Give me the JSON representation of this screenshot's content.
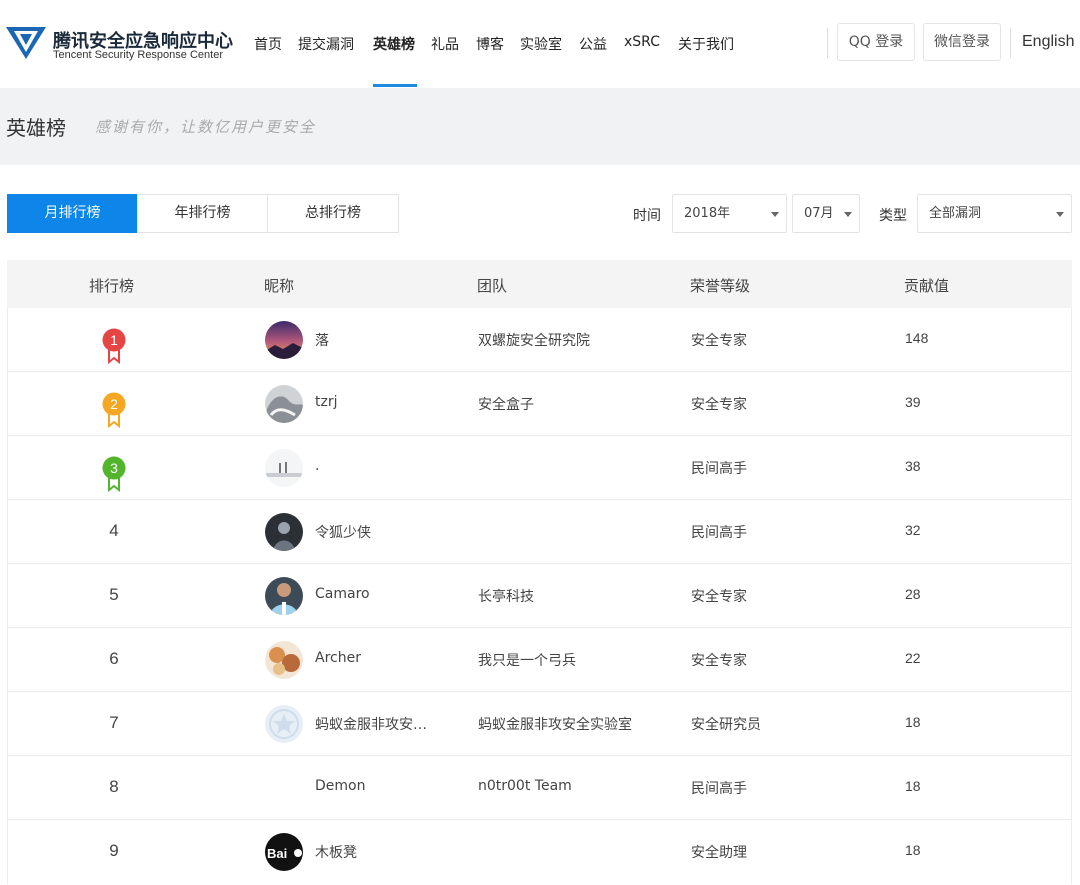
{
  "header": {
    "brand_cn": "腾讯安全应急响应中心",
    "brand_en": "Tencent Security Response Center",
    "nav": [
      {
        "label": "首页",
        "active": false
      },
      {
        "label": "提交漏洞",
        "active": false
      },
      {
        "label": "英雄榜",
        "active": true
      },
      {
        "label": "礼品",
        "active": false
      },
      {
        "label": "博客",
        "active": false
      },
      {
        "label": "实验室",
        "active": false
      },
      {
        "label": "公益",
        "active": false
      },
      {
        "label": "xSRC",
        "active": false
      },
      {
        "label": "关于我们",
        "active": false
      }
    ],
    "qq_login": "QQ 登录",
    "wechat_login": "微信登录",
    "language": "English"
  },
  "banner": {
    "title": "英雄榜",
    "slogan": "感谢有你，让数亿用户更安全"
  },
  "tabs": [
    {
      "label": "月排行榜",
      "active": true
    },
    {
      "label": "年排行榜",
      "active": false
    },
    {
      "label": "总排行榜",
      "active": false
    }
  ],
  "filters": {
    "time_label": "时间",
    "year": "2018年",
    "month": "07月",
    "type_label": "类型",
    "type": "全部漏洞"
  },
  "table": {
    "headers": [
      "排行榜",
      "昵称",
      "团队",
      "荣誉等级",
      "贡献值"
    ],
    "rows": [
      {
        "rank": "1",
        "medal": "red",
        "avatar": "sunset",
        "nickname": "落",
        "team": "双螺旋安全研究院",
        "level": "安全专家",
        "score": "148"
      },
      {
        "rank": "2",
        "medal": "orange",
        "avatar": "grey",
        "nickname": "tzrj",
        "team": "安全盒子",
        "level": "安全专家",
        "score": "39"
      },
      {
        "rank": "3",
        "medal": "green",
        "avatar": "pale",
        "nickname": ".",
        "team": "",
        "level": "民间高手",
        "score": "38"
      },
      {
        "rank": "4",
        "medal": "",
        "avatar": "dark",
        "nickname": "令狐少侠",
        "team": "",
        "level": "民间高手",
        "score": "32"
      },
      {
        "rank": "5",
        "medal": "",
        "avatar": "player",
        "nickname": "Camaro",
        "team": "长亭科技",
        "level": "安全专家",
        "score": "28"
      },
      {
        "rank": "6",
        "medal": "",
        "avatar": "food",
        "nickname": "Archer",
        "team": "我只是一个弓兵",
        "level": "安全专家",
        "score": "22"
      },
      {
        "rank": "7",
        "medal": "",
        "avatar": "default",
        "nickname": "蚂蚁金服非攻安…",
        "team": "蚂蚁金服非攻安全实验室",
        "level": "安全研究员",
        "score": "18"
      },
      {
        "rank": "8",
        "medal": "",
        "avatar": "",
        "nickname": "Demon",
        "team": "n0tr00t Team",
        "level": "民间高手",
        "score": "18"
      },
      {
        "rank": "9",
        "medal": "",
        "avatar": "baidu",
        "nickname": "木板凳",
        "team": "",
        "level": "安全助理",
        "score": "18"
      }
    ]
  },
  "colors": {
    "accent": "#0e85e8",
    "medal_red": "#e64545",
    "medal_orange": "#f5a623",
    "medal_green": "#52b52b"
  }
}
